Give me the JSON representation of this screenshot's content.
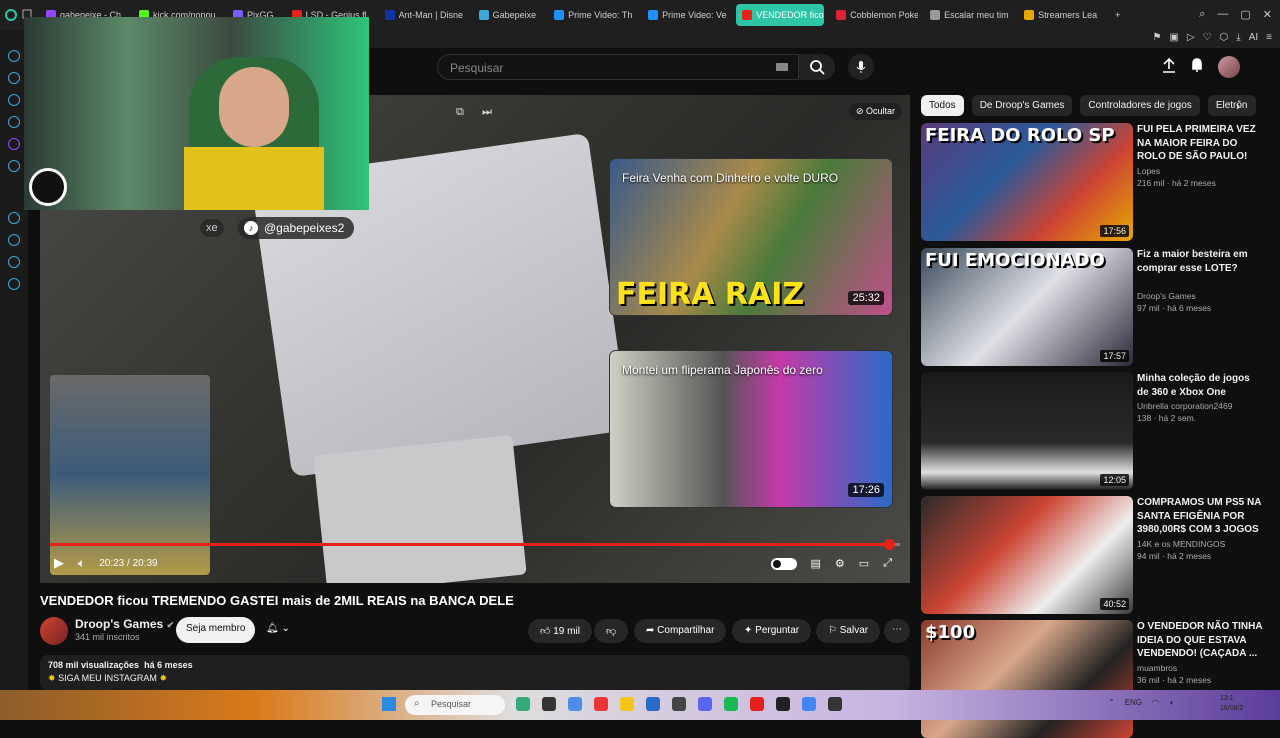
{
  "browser": {
    "tabs": [
      {
        "label": "gabepeixe - Ch",
        "color": "#9146ff"
      },
      {
        "label": "kick.com/nopou",
        "color": "#53fc18"
      },
      {
        "label": "PixGG",
        "color": "#7a5cff"
      },
      {
        "label": "LSD - Genius fl",
        "color": "#e62117"
      },
      {
        "label": "Ant-Man | Disne",
        "color": "#1133aa"
      },
      {
        "label": "Gabepeixe",
        "color": "#3aa8d8"
      },
      {
        "label": "Prime Video: Th",
        "color": "#1e90ff"
      },
      {
        "label": "Prime Video: Ve",
        "color": "#1e90ff"
      },
      {
        "label": "VENDEDOR ficou TREMEN",
        "color": "#e62117"
      },
      {
        "label": "Cobblemon Poke",
        "color": "#d23"
      },
      {
        "label": "Escalar meu tim",
        "color": "#999"
      },
      {
        "label": "Streamers Lea",
        "color": "#e6a800"
      }
    ],
    "new_tab": "+"
  },
  "header": {
    "search_placeholder": "Pesquisar"
  },
  "player": {
    "overlay_handle": "@gabepeixes2",
    "overlay_handle_left": "xe",
    "hide_label": "Ocultar",
    "time": "20:23 / 20:39",
    "progress": 0.987,
    "endcards": [
      {
        "title": "Feira Venha com Dinheiro e volte DURO",
        "big_text": "FEIRA RAIZ",
        "duration": "25:32"
      },
      {
        "title": "Montei um fliperama Japonês do zero",
        "duration": "17:26"
      }
    ]
  },
  "video": {
    "title": "VENDEDOR ficou TREMENDO GASTEI mais de 2MIL REAIS na BANCA DELE",
    "channel": "Droop's Games",
    "subscribers": "341 mil inscritos",
    "member_button": "Seja membro",
    "likes": "19 mil",
    "share": "Compartilhar",
    "ask": "Perguntar",
    "save": "Salvar",
    "views": "708 mil visualizações",
    "age": "há 6 meses",
    "description_line": "SIGA MEU INSTAGRAM"
  },
  "chips": [
    "Todos",
    "De Droop's Games",
    "Controladores de jogos",
    "Eletrôn"
  ],
  "recommendations": [
    {
      "title": "FUI PELA PRIMEIRA VEZ NA MAIOR FEIRA DO ROLO DE SÃO PAULO!",
      "channel": "Lopes",
      "meta": "216 mil · há 2 meses",
      "duration": "17:56",
      "thumb_text": "FEIRA DO ROLO SP"
    },
    {
      "title": "Fiz a maior besteira em comprar esse LOTE?",
      "channel": "Droop's Games",
      "meta": "97 mil · há 6 meses",
      "duration": "17:57",
      "thumb_text": "FUI EMOCIONADO"
    },
    {
      "title": "Minha coleção de jogos de 360 e Xbox One",
      "channel": "Unbrella corporation2469",
      "meta": "138 · há 2 sem.",
      "duration": "12:05",
      "thumb_text": ""
    },
    {
      "title": "COMPRAMOS UM PS5 NA SANTA EFIGÊNIA POR 3980,00R$ COM 3 JOGOS",
      "channel": "14K e os MENDINGOS",
      "meta": "94 mil · há 2 meses",
      "duration": "40:52",
      "thumb_text": ""
    },
    {
      "title": "O VENDEDOR NÃO TINHA IDEIA DO QUE ESTAVA VENDENDO! (CAÇADA ...",
      "channel": "muambros",
      "meta": "36 mil · há 2 meses",
      "duration": "",
      "thumb_text": "$100"
    }
  ],
  "taskbar": {
    "search_placeholder": "Pesquisar",
    "lang": "ENG",
    "time": "13:1",
    "date": "16/08/2"
  },
  "colors": {
    "accent_red": "#e62117",
    "bg": "#0f0f0f",
    "active_tab": "#2ec4a6"
  }
}
